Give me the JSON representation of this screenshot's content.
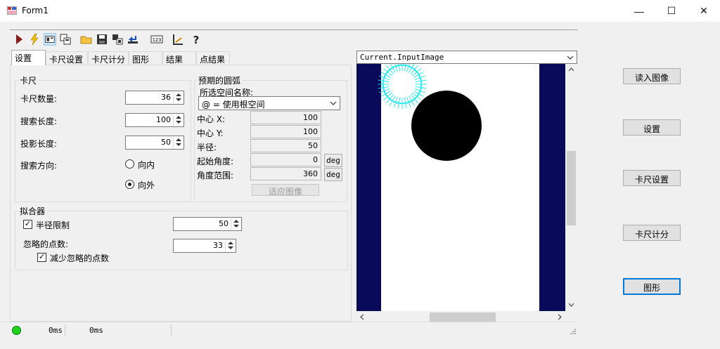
{
  "window": {
    "title": "Form1",
    "min_glyph": "—",
    "max_glyph": "☐",
    "close_glyph": "✕"
  },
  "toolbar": {
    "icons": [
      "run-icon",
      "lightning-icon",
      "image-view-icon",
      "image-copy-icon",
      "open-folder-icon",
      "save-icon",
      "export-icon",
      "undo-icon",
      "number-icon",
      "measure-icon",
      "help-icon"
    ]
  },
  "tabs": [
    "设置",
    "卡尺设置",
    "卡尺计分",
    "图形",
    "结果",
    "点结果"
  ],
  "caliper": {
    "group_label": "卡尺",
    "count_label": "卡尺数量:",
    "count_value": "36",
    "search_length_label": "搜索长度:",
    "search_length_value": "100",
    "projection_length_label": "投影长度:",
    "projection_length_value": "50",
    "direction_label": "搜索方向:",
    "inward_label": "向内",
    "outward_label": "向外",
    "selected_direction": "向外"
  },
  "expected_arc": {
    "group_label": "预期的圆弧",
    "space_label": "所选空间名称:",
    "space_value": "@ = 使用根空间",
    "center_x_label": "中心 X:",
    "center_x_value": "100",
    "center_y_label": "中心 Y:",
    "center_y_value": "100",
    "radius_label": "半径:",
    "radius_value": "50",
    "start_angle_label": "起始角度:",
    "start_angle_value": "0",
    "angle_range_label": "角度范围:",
    "angle_range_value": "360",
    "deg_label": "deg",
    "fit_image_label": "适应图像"
  },
  "fitter": {
    "group_label": "拟合器",
    "radius_limit_label": "半径限制",
    "radius_limit_checked": true,
    "radius_limit_value": "50",
    "ignored_points_label": "忽略的点数:",
    "ignored_points_value": "33",
    "reduce_ignored_label": "减少忽略的点数",
    "reduce_ignored_checked": true
  },
  "image_view": {
    "selected_image": "Current.InputImage"
  },
  "status": {
    "indicator_color": "#1ed21e",
    "time1": "0ms",
    "time2": "0ms"
  },
  "right_buttons": {
    "read_image": "读入图像",
    "settings": "设置",
    "caliper_settings": "卡尺设置",
    "caliper_scoring": "卡尺计分",
    "graphics": "图形"
  },
  "colors": {
    "accent": "#0078d7",
    "image_border": "#0a0a5a",
    "caliper_graphic": "#00e5ee"
  }
}
